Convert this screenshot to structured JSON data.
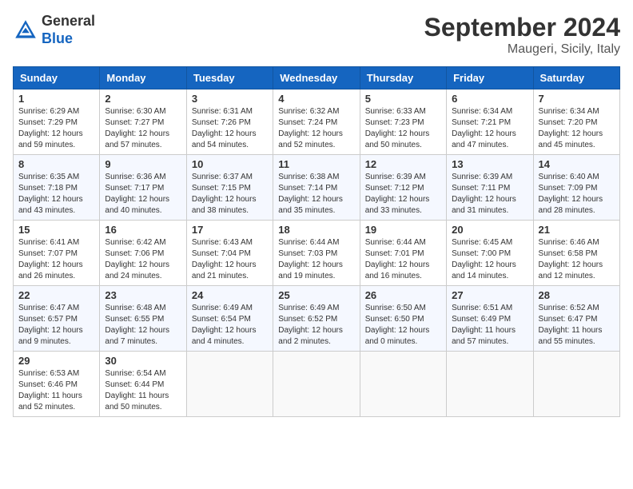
{
  "header": {
    "logo_general": "General",
    "logo_blue": "Blue",
    "month_title": "September 2024",
    "location": "Maugeri, Sicily, Italy"
  },
  "weekdays": [
    "Sunday",
    "Monday",
    "Tuesday",
    "Wednesday",
    "Thursday",
    "Friday",
    "Saturday"
  ],
  "weeks": [
    [
      {
        "day": "1",
        "sunrise": "Sunrise: 6:29 AM",
        "sunset": "Sunset: 7:29 PM",
        "daylight": "Daylight: 12 hours and 59 minutes."
      },
      {
        "day": "2",
        "sunrise": "Sunrise: 6:30 AM",
        "sunset": "Sunset: 7:27 PM",
        "daylight": "Daylight: 12 hours and 57 minutes."
      },
      {
        "day": "3",
        "sunrise": "Sunrise: 6:31 AM",
        "sunset": "Sunset: 7:26 PM",
        "daylight": "Daylight: 12 hours and 54 minutes."
      },
      {
        "day": "4",
        "sunrise": "Sunrise: 6:32 AM",
        "sunset": "Sunset: 7:24 PM",
        "daylight": "Daylight: 12 hours and 52 minutes."
      },
      {
        "day": "5",
        "sunrise": "Sunrise: 6:33 AM",
        "sunset": "Sunset: 7:23 PM",
        "daylight": "Daylight: 12 hours and 50 minutes."
      },
      {
        "day": "6",
        "sunrise": "Sunrise: 6:34 AM",
        "sunset": "Sunset: 7:21 PM",
        "daylight": "Daylight: 12 hours and 47 minutes."
      },
      {
        "day": "7",
        "sunrise": "Sunrise: 6:34 AM",
        "sunset": "Sunset: 7:20 PM",
        "daylight": "Daylight: 12 hours and 45 minutes."
      }
    ],
    [
      {
        "day": "8",
        "sunrise": "Sunrise: 6:35 AM",
        "sunset": "Sunset: 7:18 PM",
        "daylight": "Daylight: 12 hours and 43 minutes."
      },
      {
        "day": "9",
        "sunrise": "Sunrise: 6:36 AM",
        "sunset": "Sunset: 7:17 PM",
        "daylight": "Daylight: 12 hours and 40 minutes."
      },
      {
        "day": "10",
        "sunrise": "Sunrise: 6:37 AM",
        "sunset": "Sunset: 7:15 PM",
        "daylight": "Daylight: 12 hours and 38 minutes."
      },
      {
        "day": "11",
        "sunrise": "Sunrise: 6:38 AM",
        "sunset": "Sunset: 7:14 PM",
        "daylight": "Daylight: 12 hours and 35 minutes."
      },
      {
        "day": "12",
        "sunrise": "Sunrise: 6:39 AM",
        "sunset": "Sunset: 7:12 PM",
        "daylight": "Daylight: 12 hours and 33 minutes."
      },
      {
        "day": "13",
        "sunrise": "Sunrise: 6:39 AM",
        "sunset": "Sunset: 7:11 PM",
        "daylight": "Daylight: 12 hours and 31 minutes."
      },
      {
        "day": "14",
        "sunrise": "Sunrise: 6:40 AM",
        "sunset": "Sunset: 7:09 PM",
        "daylight": "Daylight: 12 hours and 28 minutes."
      }
    ],
    [
      {
        "day": "15",
        "sunrise": "Sunrise: 6:41 AM",
        "sunset": "Sunset: 7:07 PM",
        "daylight": "Daylight: 12 hours and 26 minutes."
      },
      {
        "day": "16",
        "sunrise": "Sunrise: 6:42 AM",
        "sunset": "Sunset: 7:06 PM",
        "daylight": "Daylight: 12 hours and 24 minutes."
      },
      {
        "day": "17",
        "sunrise": "Sunrise: 6:43 AM",
        "sunset": "Sunset: 7:04 PM",
        "daylight": "Daylight: 12 hours and 21 minutes."
      },
      {
        "day": "18",
        "sunrise": "Sunrise: 6:44 AM",
        "sunset": "Sunset: 7:03 PM",
        "daylight": "Daylight: 12 hours and 19 minutes."
      },
      {
        "day": "19",
        "sunrise": "Sunrise: 6:44 AM",
        "sunset": "Sunset: 7:01 PM",
        "daylight": "Daylight: 12 hours and 16 minutes."
      },
      {
        "day": "20",
        "sunrise": "Sunrise: 6:45 AM",
        "sunset": "Sunset: 7:00 PM",
        "daylight": "Daylight: 12 hours and 14 minutes."
      },
      {
        "day": "21",
        "sunrise": "Sunrise: 6:46 AM",
        "sunset": "Sunset: 6:58 PM",
        "daylight": "Daylight: 12 hours and 12 minutes."
      }
    ],
    [
      {
        "day": "22",
        "sunrise": "Sunrise: 6:47 AM",
        "sunset": "Sunset: 6:57 PM",
        "daylight": "Daylight: 12 hours and 9 minutes."
      },
      {
        "day": "23",
        "sunrise": "Sunrise: 6:48 AM",
        "sunset": "Sunset: 6:55 PM",
        "daylight": "Daylight: 12 hours and 7 minutes."
      },
      {
        "day": "24",
        "sunrise": "Sunrise: 6:49 AM",
        "sunset": "Sunset: 6:54 PM",
        "daylight": "Daylight: 12 hours and 4 minutes."
      },
      {
        "day": "25",
        "sunrise": "Sunrise: 6:49 AM",
        "sunset": "Sunset: 6:52 PM",
        "daylight": "Daylight: 12 hours and 2 minutes."
      },
      {
        "day": "26",
        "sunrise": "Sunrise: 6:50 AM",
        "sunset": "Sunset: 6:50 PM",
        "daylight": "Daylight: 12 hours and 0 minutes."
      },
      {
        "day": "27",
        "sunrise": "Sunrise: 6:51 AM",
        "sunset": "Sunset: 6:49 PM",
        "daylight": "Daylight: 11 hours and 57 minutes."
      },
      {
        "day": "28",
        "sunrise": "Sunrise: 6:52 AM",
        "sunset": "Sunset: 6:47 PM",
        "daylight": "Daylight: 11 hours and 55 minutes."
      }
    ],
    [
      {
        "day": "29",
        "sunrise": "Sunrise: 6:53 AM",
        "sunset": "Sunset: 6:46 PM",
        "daylight": "Daylight: 11 hours and 52 minutes."
      },
      {
        "day": "30",
        "sunrise": "Sunrise: 6:54 AM",
        "sunset": "Sunset: 6:44 PM",
        "daylight": "Daylight: 11 hours and 50 minutes."
      },
      null,
      null,
      null,
      null,
      null
    ]
  ]
}
